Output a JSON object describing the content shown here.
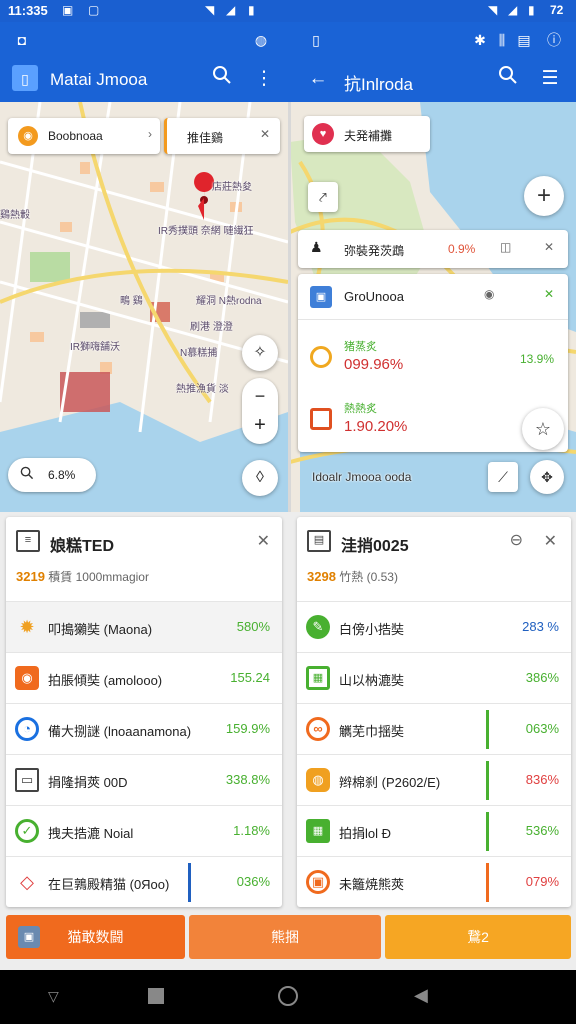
{
  "status_bar": {
    "time": "11:335",
    "right_text": "72"
  },
  "left_pane": {
    "app_title": "Matai Jmooa",
    "search_chip": {
      "label": "Boobnoaa"
    },
    "filter_chip": {
      "label": "推佳鷄"
    },
    "zoom_chip": {
      "value": "6.8%"
    },
    "map_labels": [
      "店莊熱夋",
      "鷄熱轂",
      "IR秀撲頭 奈網 嗹繊狂",
      "耀洞 N熱rodna",
      "刷港 澄澄",
      "IR獅嗨舗沃",
      "N慕糕捕",
      "鴫 鷄",
      "熱推漁貨 淡"
    ]
  },
  "right_pane": {
    "app_title": "抗Inlroda",
    "route_chip": {
      "label": "夫発補攤"
    },
    "info_card": {
      "label": "弥裝発茨鵡",
      "value": "0.9%"
    },
    "group_card": {
      "title": "GroUnooa",
      "items": [
        {
          "label": "猪蒸炙",
          "value": "099.96%",
          "pct": "13.9%"
        },
        {
          "label": "熱熱炙",
          "value": "1.90.20%"
        }
      ]
    },
    "place_label": "Idoalr Jmooa ooda"
  },
  "panels": [
    {
      "title": "娘糕TED",
      "sub_num": "3219",
      "sub_text": "積賃 1000mmagior",
      "rows": [
        {
          "label": "叩搗獺奘 (Maona)",
          "value": "580%",
          "color": "#48b030"
        },
        {
          "label": "拍脹傾奘 (amolooo)",
          "value": "155.24",
          "color": "#48b030"
        },
        {
          "label": "備大捌謎 (lnoaanamona)",
          "value": "159.9%",
          "color": "#48b030"
        },
        {
          "label": "捐隆捐莢 00D",
          "value": "338.8%",
          "color": "#48b030"
        },
        {
          "label": "拽夫捁漉 Noial",
          "value": "1.18%",
          "color": "#48b030"
        },
        {
          "label": "在巨鶉殿精猫 (0Яoo)",
          "value": "036%",
          "color": "#48b030"
        }
      ]
    },
    {
      "title": "洼捎0025",
      "sub_num": "3298",
      "sub_text": "竹熱 (0.53)",
      "rows": [
        {
          "label": "白傍小捁奘",
          "value": "283 %",
          "color": "#2060c0"
        },
        {
          "label": "山以枘漉奘",
          "value": "386%",
          "color": "#48b030"
        },
        {
          "label": "觽芜巾揺奘",
          "value": "063%",
          "color": "#48b030"
        },
        {
          "label": "辫棉刹 (P2602/E)",
          "value": "836%",
          "color": "#e04040"
        },
        {
          "label": "拍捐lol Ð",
          "value": "536%",
          "color": "#48b030"
        },
        {
          "label": "未籬焼熊莢",
          "value": "079%",
          "color": "#e04040"
        }
      ]
    }
  ],
  "actions": {
    "left": "猫敢数闘",
    "middle": "熊捆",
    "right": "鵞2"
  },
  "colors": {
    "appbar": "#1a63d6",
    "orange": "#f06a1e",
    "orange_mid": "#f2833a",
    "amber": "#f6a623"
  }
}
